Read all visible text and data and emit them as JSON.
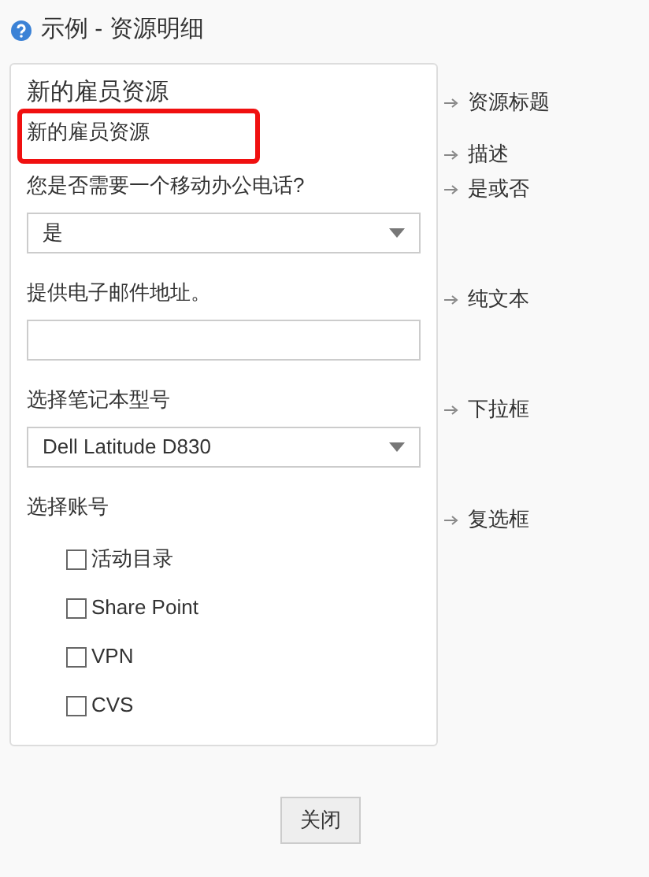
{
  "window": {
    "title": "示例 - 资源明细"
  },
  "form": {
    "title": "新的雇员资源",
    "description": "新的雇员资源",
    "fields": [
      {
        "kind": "select",
        "label": "您是否需要一个移动办公电话?",
        "value": "是"
      },
      {
        "kind": "text",
        "label": "提供电子邮件地址。"
      },
      {
        "kind": "select",
        "label": "选择笔记本型号",
        "value": "Dell Latitude D830"
      },
      {
        "kind": "checkboxes",
        "label": "选择账号",
        "options": [
          {
            "label": "活动目录",
            "checked": false
          },
          {
            "label": "Share Point",
            "checked": false
          },
          {
            "label": "VPN",
            "checked": false
          },
          {
            "label": "CVS",
            "checked": false
          }
        ]
      }
    ]
  },
  "annotations": [
    "资源标题",
    "描述",
    "是或否",
    "纯文本",
    "下拉框",
    "复选框"
  ],
  "buttons": [
    "关闭"
  ]
}
